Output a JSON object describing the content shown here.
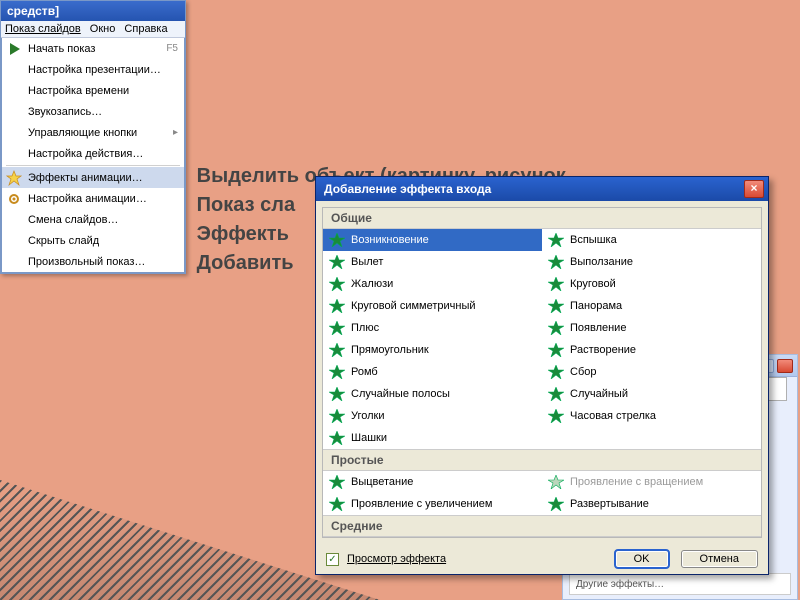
{
  "colors": {
    "accent": "#2a63cf",
    "xp_beige": "#ece9d8",
    "selection": "#316ac5"
  },
  "bullets": [
    "Выделить объект (картинку, рисунок…",
    "Показ сла",
    "Эффекть",
    "Добавить"
  ],
  "tl_window": {
    "title": "средств]",
    "menubar": [
      "Показ слайдов",
      "Окно",
      "Справка"
    ],
    "items": [
      {
        "label": "Начать показ",
        "shortcut": "F5",
        "icon": "play"
      },
      {
        "label": "Настройка презентации…"
      },
      {
        "label": "Настройка времени"
      },
      {
        "label": "Звукозапись…"
      },
      {
        "label": "Управляющие кнопки",
        "submenu": true
      },
      {
        "label": "Настройка действия…"
      },
      {
        "sep": true
      },
      {
        "label": "Эффекты анимации…",
        "icon": "star",
        "highlighted": true
      },
      {
        "label": "Настройка анимации…",
        "icon": "gear"
      },
      {
        "label": "Смена слайдов…"
      },
      {
        "label": "Скрыть слайд"
      },
      {
        "label": "Произвольный показ…"
      }
    ]
  },
  "dialog": {
    "title": "Добавление эффекта входа",
    "sections": [
      {
        "header": "Общие",
        "effects": [
          {
            "name": "Возникновение",
            "selected": true
          },
          {
            "name": "Вспышка"
          },
          {
            "name": "Вылет"
          },
          {
            "name": "Выползание"
          },
          {
            "name": "Жалюзи"
          },
          {
            "name": "Круговой"
          },
          {
            "name": "Круговой симметричный"
          },
          {
            "name": "Панорама"
          },
          {
            "name": "Плюс"
          },
          {
            "name": "Появление"
          },
          {
            "name": "Прямоугольник"
          },
          {
            "name": "Растворение"
          },
          {
            "name": "Ромб"
          },
          {
            "name": "Сбор"
          },
          {
            "name": "Случайные полосы"
          },
          {
            "name": "Случайный"
          },
          {
            "name": "Уголки"
          },
          {
            "name": "Часовая стрелка"
          },
          {
            "name": "Шашки"
          }
        ]
      },
      {
        "header": "Простые",
        "effects": [
          {
            "name": "Выцветание"
          },
          {
            "name": "Проявление с вращением",
            "disabled": true
          },
          {
            "name": "Проявление с увеличением"
          },
          {
            "name": "Развертывание"
          }
        ]
      },
      {
        "header": "Средние",
        "effects": []
      }
    ],
    "preview_label": "Просмотр эффекта",
    "preview_checked": true,
    "ok": "OK",
    "cancel": "Отмена"
  },
  "bgwin": {
    "bottom_text": "Другие эффекты…"
  }
}
